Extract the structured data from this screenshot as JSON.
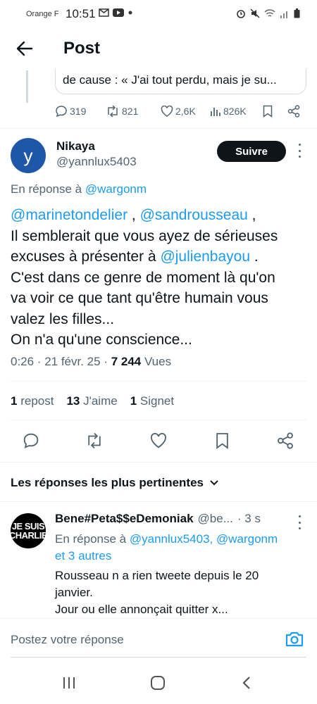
{
  "status_bar": {
    "carrier": "Orange F",
    "time": "10:51"
  },
  "app_bar": {
    "title": "Post"
  },
  "quoted_post": {
    "text": "de cause : « J'ai tout perdu, mais je su..."
  },
  "previous_metrics": {
    "replies": "319",
    "reposts": "821",
    "likes": "2,6K",
    "views": "826K"
  },
  "post": {
    "display_name": "Nikaya",
    "handle": "@yannlux5403",
    "avatar_letter": "y",
    "follow_label": "Suivre",
    "reply_to_prefix": "En réponse à",
    "reply_to_handle": "@wargonm",
    "mention1": "@marinetondelier",
    "mention_sep": " , ",
    "mention2": "@sandrousseau",
    "mention_end": " ,",
    "line2": "Il semblerait que vous ayez de sérieuses",
    "line3_before": "excuses à présenter à ",
    "mention3": "@julienbayou",
    "line3_after": " .",
    "line4": "C'est dans ce genre de moment là qu'on",
    "line5": "va voir ce que tant qu'être humain vous",
    "line6": "valez les filles...",
    "line7": "On n'a qu'une conscience...",
    "timestamp": "0:26 · 21 févr. 25 · ",
    "views_count": "7 244",
    "views_label": " Vues"
  },
  "stats": {
    "reposts_count": "1",
    "reposts_label": "repost",
    "likes_count": "13",
    "likes_label": "J'aime",
    "bookmarks_count": "1",
    "bookmarks_label": "Signet"
  },
  "replies_section": {
    "sort_label": "Les réponses les plus pertinentes"
  },
  "reply": {
    "avatar_line1": "JE SUIS",
    "avatar_line2": "CHARLIE",
    "display_name": "Bene#Peta$$eDemoniak",
    "handle": "@be...",
    "time": "· 3 s",
    "reply_to_prefix": "En réponse à",
    "reply_to_handles": "@yannlux5403, @wargonm",
    "reply_to_more": "et 3 autres",
    "text_line1": "Rousseau n a rien tweete depuis le 20",
    "text_line2": "janvier.",
    "text_line3": "Jour ou elle annonçait quitter x..."
  },
  "compose": {
    "placeholder": "Postez votre réponse"
  },
  "colors": {
    "accent": "#1d9bf0",
    "text": "#0f1419",
    "muted": "#536471"
  }
}
